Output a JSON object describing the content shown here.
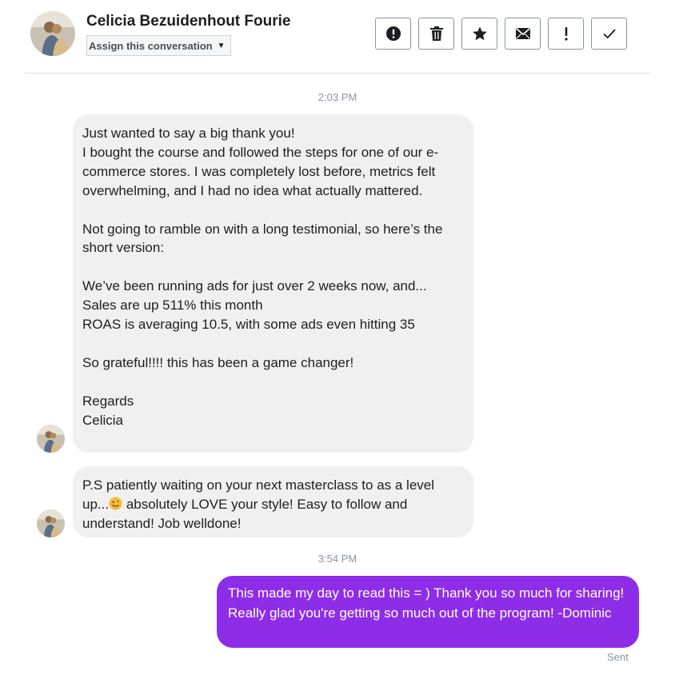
{
  "header": {
    "contact_name": "Celicia Bezuidenhout Fourie",
    "assign_label": "Assign this conversation",
    "actions": [
      {
        "name": "mark-spam",
        "icon": "exclamation-circle-icon"
      },
      {
        "name": "delete",
        "icon": "trash-icon"
      },
      {
        "name": "star",
        "icon": "star-icon"
      },
      {
        "name": "mark-unread",
        "icon": "envelope-icon"
      },
      {
        "name": "follow-up",
        "icon": "exclamation-icon"
      },
      {
        "name": "mark-done",
        "icon": "checkmark-icon"
      }
    ]
  },
  "conversation": {
    "timestamp_1": "2:03 PM",
    "message_1": {
      "para_1": "Just wanted to say a big thank you!\nI bought the course and followed the steps for one of our e-commerce stores. I was completely lost before, metrics felt overwhelming, and I had no idea what actually mattered.",
      "para_2": "Not going to ramble on with a long testimonial, so here’s the short version:",
      "para_3": "We’ve been running ads for just over 2 weeks now, and...\nSales are up 511% this month\nROAS is averaging 10.5, with some ads even hitting 35",
      "para_4": "So grateful!!!! this has been a game changer!",
      "para_5": "Regards\nCelicia"
    },
    "message_2": {
      "before_emoji": "P.S patiently waiting on your next masterclass to as a level up...",
      "emoji": "slightly-smiling-face-emoji",
      "after_emoji": " absolutely LOVE your style! Easy to follow and understand! Job welldone!"
    },
    "timestamp_2": "3:54 PM",
    "reply": "This made my day to read this = ) Thank you so much for sharing! Really glad you're getting so much out of the program! -Dominic",
    "reply_status": "Sent"
  },
  "colors": {
    "outgoing_bubble": "#8e2de8",
    "incoming_bubble": "#f0f0f0",
    "muted_text": "#8d949e"
  }
}
